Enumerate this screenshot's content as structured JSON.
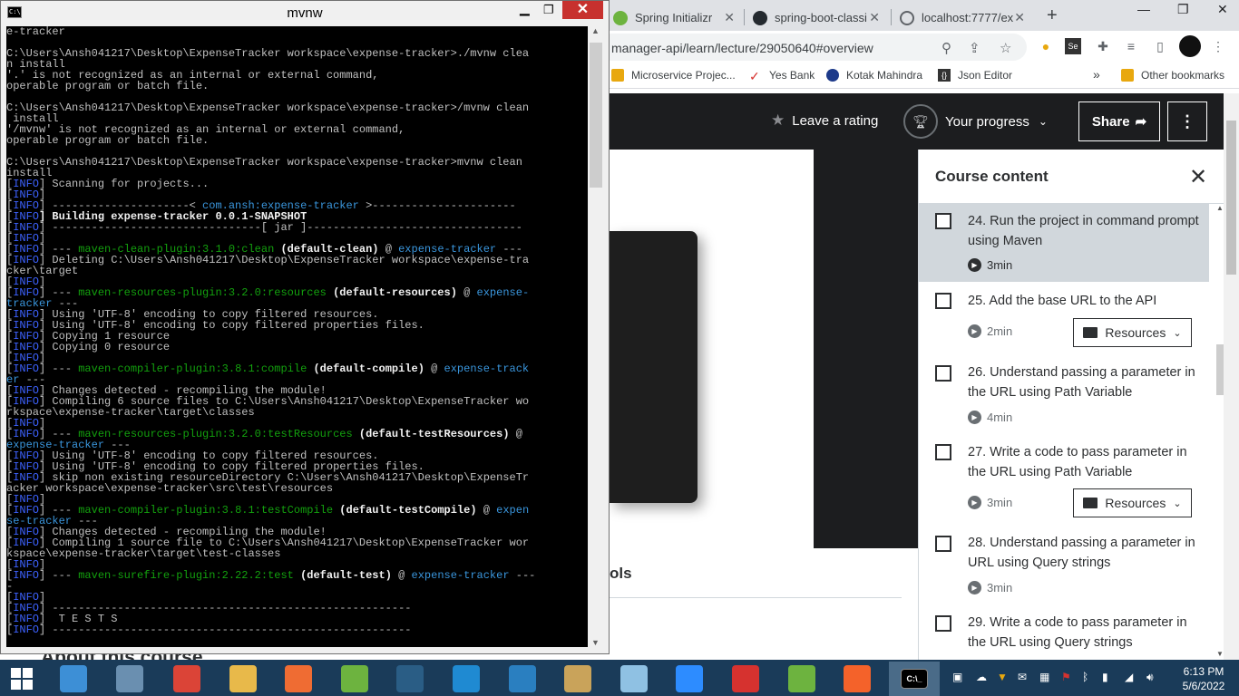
{
  "browser": {
    "tabs": [
      {
        "label": "Spring Initializr"
      },
      {
        "label": "spring-boot-classi"
      },
      {
        "label": "localhost:7777/ex"
      }
    ],
    "new_tab": "+",
    "url": "manager-api/learn/lecture/29050640#overview",
    "bookmarks": [
      {
        "label": "Microservice Projec..."
      },
      {
        "label": "Yes Bank"
      },
      {
        "label": "Kotak Mahindra"
      },
      {
        "label": "Json Editor"
      },
      {
        "label": "»"
      },
      {
        "label": "Other bookmarks"
      }
    ]
  },
  "udemy": {
    "leave_rating": "Leave a rating",
    "your_progress": "Your progress",
    "share": "Share",
    "tools_fragment": "ols",
    "about_heading": "About this course"
  },
  "course_content": {
    "title": "Course content",
    "lectures": [
      {
        "title": "24. Run the project in command prompt using Maven",
        "duration": "3min",
        "active": true
      },
      {
        "title": "25. Add the base URL to the API",
        "duration": "2min",
        "resources": "Resources"
      },
      {
        "title": "26. Understand passing a parameter in the URL using Path Variable",
        "duration": "4min"
      },
      {
        "title": "27. Write a code to pass parameter in the URL using Path Variable",
        "duration": "3min",
        "resources": "Resources"
      },
      {
        "title": "28. Understand passing a parameter in URL using Query strings",
        "duration": "3min"
      },
      {
        "title": "29. Write a code to pass parameter in the URL using Query strings",
        "duration": ""
      }
    ]
  },
  "console": {
    "title": "mvnw",
    "lines": [
      [
        [
          "",
          "e-tracker"
        ]
      ],
      [
        [
          "",
          ""
        ]
      ],
      [
        [
          "",
          "C:\\Users\\Ansh041217\\Desktop\\ExpenseTracker workspace\\expense-tracker>./mvnw clea"
        ]
      ],
      [
        [
          "",
          "n install"
        ]
      ],
      [
        [
          "",
          "'.' is not recognized as an internal or external command,"
        ]
      ],
      [
        [
          "",
          "operable program or batch file."
        ]
      ],
      [
        [
          "",
          ""
        ]
      ],
      [
        [
          "",
          "C:\\Users\\Ansh041217\\Desktop\\ExpenseTracker workspace\\expense-tracker>/mvnw clean"
        ]
      ],
      [
        [
          "",
          " install"
        ]
      ],
      [
        [
          "",
          "'/mvnw' is not recognized as an internal or external command,"
        ]
      ],
      [
        [
          "",
          "operable program or batch file."
        ]
      ],
      [
        [
          "",
          ""
        ]
      ],
      [
        [
          "",
          "C:\\Users\\Ansh041217\\Desktop\\ExpenseTracker workspace\\expense-tracker>mvnw clean"
        ]
      ],
      [
        [
          "",
          "install"
        ]
      ],
      [
        [
          "",
          "["
        ],
        [
          "info",
          "INFO"
        ],
        [
          "",
          "] Scanning for projects..."
        ]
      ],
      [
        [
          "",
          "["
        ],
        [
          "info",
          "INFO"
        ],
        [
          "",
          "]"
        ]
      ],
      [
        [
          "",
          "["
        ],
        [
          "info",
          "INFO"
        ],
        [
          "",
          "] ---------------------< "
        ],
        [
          "cyan",
          "com.ansh:expense-tracker"
        ],
        [
          "",
          " >----------------------"
        ]
      ],
      [
        [
          "",
          "["
        ],
        [
          "info",
          "INFO"
        ],
        [
          "white",
          "] Building expense-tracker 0.0.1-SNAPSHOT"
        ]
      ],
      [
        [
          "",
          "["
        ],
        [
          "info",
          "INFO"
        ],
        [
          "",
          "] --------------------------------[ jar ]---------------------------------"
        ]
      ],
      [
        [
          "",
          "["
        ],
        [
          "info",
          "INFO"
        ],
        [
          "",
          "]"
        ]
      ],
      [
        [
          "",
          "["
        ],
        [
          "info",
          "INFO"
        ],
        [
          "",
          "] --- "
        ],
        [
          "green",
          "maven-clean-plugin:3.1.0:clean"
        ],
        [
          "white",
          " (default-clean)"
        ],
        [
          "",
          " @ "
        ],
        [
          "cyan",
          "expense-tracker"
        ],
        [
          "",
          " ---"
        ]
      ],
      [
        [
          "",
          "["
        ],
        [
          "info",
          "INFO"
        ],
        [
          "",
          "] Deleting C:\\Users\\Ansh041217\\Desktop\\ExpenseTracker workspace\\expense-tra"
        ]
      ],
      [
        [
          "",
          "cker\\target"
        ]
      ],
      [
        [
          "",
          "["
        ],
        [
          "info",
          "INFO"
        ],
        [
          "",
          "]"
        ]
      ],
      [
        [
          "",
          "["
        ],
        [
          "info",
          "INFO"
        ],
        [
          "",
          "] --- "
        ],
        [
          "green",
          "maven-resources-plugin:3.2.0:resources"
        ],
        [
          "white",
          " (default-resources)"
        ],
        [
          "",
          " @ "
        ],
        [
          "cyan",
          "expense-"
        ]
      ],
      [
        [
          "cyan",
          "tracker"
        ],
        [
          "",
          " ---"
        ]
      ],
      [
        [
          "",
          "["
        ],
        [
          "info",
          "INFO"
        ],
        [
          "",
          "] Using 'UTF-8' encoding to copy filtered resources."
        ]
      ],
      [
        [
          "",
          "["
        ],
        [
          "info",
          "INFO"
        ],
        [
          "",
          "] Using 'UTF-8' encoding to copy filtered properties files."
        ]
      ],
      [
        [
          "",
          "["
        ],
        [
          "info",
          "INFO"
        ],
        [
          "",
          "] Copying 1 resource"
        ]
      ],
      [
        [
          "",
          "["
        ],
        [
          "info",
          "INFO"
        ],
        [
          "",
          "] Copying 0 resource"
        ]
      ],
      [
        [
          "",
          "["
        ],
        [
          "info",
          "INFO"
        ],
        [
          "",
          "]"
        ]
      ],
      [
        [
          "",
          "["
        ],
        [
          "info",
          "INFO"
        ],
        [
          "",
          "] --- "
        ],
        [
          "green",
          "maven-compiler-plugin:3.8.1:compile"
        ],
        [
          "white",
          " (default-compile)"
        ],
        [
          "",
          " @ "
        ],
        [
          "cyan",
          "expense-track"
        ]
      ],
      [
        [
          "cyan",
          "er"
        ],
        [
          "",
          " ---"
        ]
      ],
      [
        [
          "",
          "["
        ],
        [
          "info",
          "INFO"
        ],
        [
          "",
          "] Changes detected - recompiling the module!"
        ]
      ],
      [
        [
          "",
          "["
        ],
        [
          "info",
          "INFO"
        ],
        [
          "",
          "] Compiling 6 source files to C:\\Users\\Ansh041217\\Desktop\\ExpenseTracker wo"
        ]
      ],
      [
        [
          "",
          "rkspace\\expense-tracker\\target\\classes"
        ]
      ],
      [
        [
          "",
          "["
        ],
        [
          "info",
          "INFO"
        ],
        [
          "",
          "]"
        ]
      ],
      [
        [
          "",
          "["
        ],
        [
          "info",
          "INFO"
        ],
        [
          "",
          "] --- "
        ],
        [
          "green",
          "maven-resources-plugin:3.2.0:testResources"
        ],
        [
          "white",
          " (default-testResources)"
        ],
        [
          "",
          " @"
        ]
      ],
      [
        [
          "cyan",
          "expense-tracker"
        ],
        [
          "",
          " ---"
        ]
      ],
      [
        [
          "",
          "["
        ],
        [
          "info",
          "INFO"
        ],
        [
          "",
          "] Using 'UTF-8' encoding to copy filtered resources."
        ]
      ],
      [
        [
          "",
          "["
        ],
        [
          "info",
          "INFO"
        ],
        [
          "",
          "] Using 'UTF-8' encoding to copy filtered properties files."
        ]
      ],
      [
        [
          "",
          "["
        ],
        [
          "info",
          "INFO"
        ],
        [
          "",
          "] skip non existing resourceDirectory C:\\Users\\Ansh041217\\Desktop\\ExpenseTr"
        ]
      ],
      [
        [
          "",
          "acker workspace\\expense-tracker\\src\\test\\resources"
        ]
      ],
      [
        [
          "",
          "["
        ],
        [
          "info",
          "INFO"
        ],
        [
          "",
          "]"
        ]
      ],
      [
        [
          "",
          "["
        ],
        [
          "info",
          "INFO"
        ],
        [
          "",
          "] --- "
        ],
        [
          "green",
          "maven-compiler-plugin:3.8.1:testCompile"
        ],
        [
          "white",
          " (default-testCompile)"
        ],
        [
          "",
          " @ "
        ],
        [
          "cyan",
          "expen"
        ]
      ],
      [
        [
          "cyan",
          "se-tracker"
        ],
        [
          "",
          " ---"
        ]
      ],
      [
        [
          "",
          "["
        ],
        [
          "info",
          "INFO"
        ],
        [
          "",
          "] Changes detected - recompiling the module!"
        ]
      ],
      [
        [
          "",
          "["
        ],
        [
          "info",
          "INFO"
        ],
        [
          "",
          "] Compiling 1 source file to C:\\Users\\Ansh041217\\Desktop\\ExpenseTracker wor"
        ]
      ],
      [
        [
          "",
          "kspace\\expense-tracker\\target\\test-classes"
        ]
      ],
      [
        [
          "",
          "["
        ],
        [
          "info",
          "INFO"
        ],
        [
          "",
          "]"
        ]
      ],
      [
        [
          "",
          "["
        ],
        [
          "info",
          "INFO"
        ],
        [
          "",
          "] --- "
        ],
        [
          "green",
          "maven-surefire-plugin:2.22.2:test"
        ],
        [
          "white",
          " (default-test)"
        ],
        [
          "",
          " @ "
        ],
        [
          "cyan",
          "expense-tracker"
        ],
        [
          "",
          " ---"
        ]
      ],
      [
        [
          "",
          "-"
        ]
      ],
      [
        [
          "",
          "["
        ],
        [
          "info",
          "INFO"
        ],
        [
          "",
          "]"
        ]
      ],
      [
        [
          "",
          "["
        ],
        [
          "info",
          "INFO"
        ],
        [
          "",
          "] -------------------------------------------------------"
        ]
      ],
      [
        [
          "",
          "["
        ],
        [
          "info",
          "INFO"
        ],
        [
          "",
          "]  T E S T S"
        ]
      ],
      [
        [
          "",
          "["
        ],
        [
          "info",
          "INFO"
        ],
        [
          "",
          "] -------------------------------------------------------"
        ]
      ]
    ]
  },
  "taskbar": {
    "clock_time": "6:13 PM",
    "clock_date": "5/6/2022",
    "apps": [
      {
        "icon": "control-panel-icon",
        "color": "#3d8fd6"
      },
      {
        "icon": "calculator-icon",
        "color": "#6a8fb0"
      },
      {
        "icon": "chrome-icon",
        "color": "#db4437"
      },
      {
        "icon": "file-explorer-icon",
        "color": "#e8b94a"
      },
      {
        "icon": "postman-icon",
        "color": "#ef6c33"
      },
      {
        "icon": "spring-tool-suite-icon",
        "color": "#6db33f"
      },
      {
        "icon": "mysql-workbench-icon",
        "color": "#2a5d85"
      },
      {
        "icon": "vscode-icon",
        "color": "#1f8ad2"
      },
      {
        "icon": "share-icon",
        "color": "#2a7fc0"
      },
      {
        "icon": "paint-icon",
        "color": "#c9a35a"
      },
      {
        "icon": "notepad-icon",
        "color": "#8fc1e3"
      },
      {
        "icon": "zoom-icon",
        "color": "#2d8cff"
      },
      {
        "icon": "opera-icon",
        "color": "#d6322f"
      },
      {
        "icon": "spring-tool-suite-icon",
        "color": "#6db33f"
      },
      {
        "icon": "feather-icon",
        "color": "#f4622a"
      },
      {
        "icon": "command-prompt-icon",
        "color": "#000000",
        "active": true
      }
    ]
  }
}
